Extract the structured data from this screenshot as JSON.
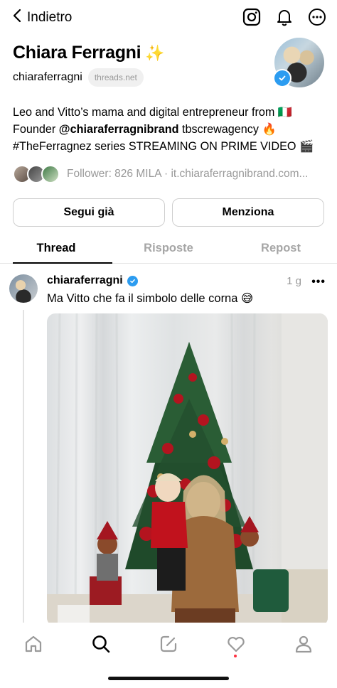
{
  "header": {
    "back_label": "Indietro",
    "icons": [
      "chevron-left-icon",
      "instagram-icon",
      "bell-icon",
      "more-circle-icon"
    ]
  },
  "profile": {
    "name": "Chiara Ferragni",
    "name_emoji": "✨",
    "handle": "chiaraferragni",
    "domain_pill": "threads.net",
    "bio_lines": [
      "Leo and Vitto’s mama and digital entrepreneur from 🇮🇹",
      "Founder ",
      "@chiaraferragnibrand",
      " tbscrewagency 🔥",
      "#TheFerragnez series STREAMING ON PRIME VIDEO 🎬"
    ],
    "followers_text": "Follower: 826 MILA · it.chiaraferragnibrand.com..."
  },
  "buttons": {
    "follow": "Segui già",
    "mention": "Menziona"
  },
  "tabs": [
    {
      "label": "Thread",
      "active": true
    },
    {
      "label": "Risposte",
      "active": false
    },
    {
      "label": "Repost",
      "active": false
    }
  ],
  "post": {
    "username": "chiaraferragni",
    "time": "1 g",
    "more": "•••",
    "text": "Ma Vitto che fa il simbolo delle corna 😅"
  },
  "bottom_nav": [
    {
      "icon": "home-icon"
    },
    {
      "icon": "search-icon",
      "active": true
    },
    {
      "icon": "compose-icon"
    },
    {
      "icon": "heart-icon",
      "notification_dot": true
    },
    {
      "icon": "profile-icon"
    }
  ],
  "colors": {
    "verified_blue": "#2c9cf0",
    "muted_text": "#999999",
    "notification_red": "#ff3040"
  }
}
